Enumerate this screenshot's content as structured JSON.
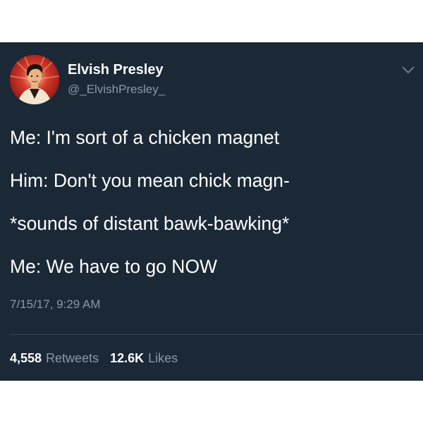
{
  "author": {
    "name": "Elvish Presley",
    "handle": "@_ElvishPresley_"
  },
  "tweet": {
    "lines": [
      "Me: I'm sort of a chicken magnet",
      "Him: Don't you mean chick magn-",
      "*sounds of distant bawk-bawking*",
      "Me: We have to go NOW"
    ],
    "timestamp": "7/15/17, 9:29 AM"
  },
  "stats": {
    "retweets_count": "4,558",
    "retweets_label": "Retweets",
    "likes_count": "12.6K",
    "likes_label": "Likes"
  },
  "icons": {
    "menu": "chevron-down-icon",
    "avatar": "profile-avatar"
  },
  "colors": {
    "background": "#1b2836",
    "text": "#ffffff",
    "secondary_text": "#8b98a5",
    "avatar_accent": "#b81d1d"
  }
}
